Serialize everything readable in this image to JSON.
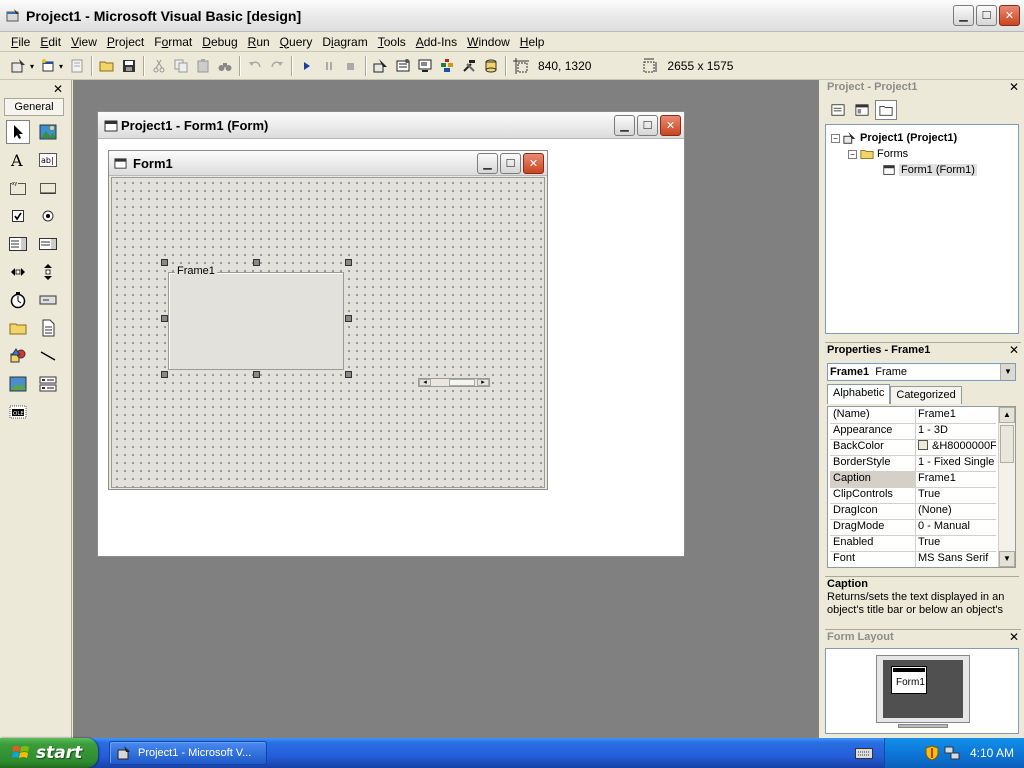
{
  "window": {
    "title": "Project1 - Microsoft Visual Basic [design]"
  },
  "menu": [
    {
      "label": "File",
      "key": "F"
    },
    {
      "label": "Edit",
      "key": "E"
    },
    {
      "label": "View",
      "key": "V"
    },
    {
      "label": "Project",
      "key": "P"
    },
    {
      "label": "Format",
      "key": "o"
    },
    {
      "label": "Debug",
      "key": "D"
    },
    {
      "label": "Run",
      "key": "R"
    },
    {
      "label": "Query",
      "key": "Q"
    },
    {
      "label": "Diagram",
      "key": "i"
    },
    {
      "label": "Tools",
      "key": "T"
    },
    {
      "label": "Add-Ins",
      "key": "A"
    },
    {
      "label": "Window",
      "key": "W"
    },
    {
      "label": "Help",
      "key": "H"
    }
  ],
  "toolbar": {
    "position": "840, 1320",
    "size": "2655 x 1575"
  },
  "toolbox": {
    "tab_label": "General"
  },
  "child_window": {
    "title": "Project1 - Form1 (Form)"
  },
  "form": {
    "title": "Form1",
    "frame_caption": "Frame1"
  },
  "project_explorer": {
    "header": "Project - Project1",
    "root": "Project1 (Project1)",
    "folder": "Forms",
    "item": "Form1 (Form1)"
  },
  "properties": {
    "header": "Properties - Frame1",
    "object_name": "Frame1",
    "object_type": "Frame",
    "tabs": [
      "Alphabetic",
      "Categorized"
    ],
    "rows": [
      {
        "name": "(Name)",
        "value": "Frame1"
      },
      {
        "name": "Appearance",
        "value": "1 - 3D"
      },
      {
        "name": "BackColor",
        "value": "&H8000000F"
      },
      {
        "name": "BorderStyle",
        "value": "1 - Fixed Single"
      },
      {
        "name": "Caption",
        "value": "Frame1"
      },
      {
        "name": "ClipControls",
        "value": "True"
      },
      {
        "name": "DragIcon",
        "value": "(None)"
      },
      {
        "name": "DragMode",
        "value": "0 - Manual"
      },
      {
        "name": "Enabled",
        "value": "True"
      },
      {
        "name": "Font",
        "value": "MS Sans Serif"
      }
    ],
    "selected": "Caption",
    "description_title": "Caption",
    "description_text": "Returns/sets the text displayed in an object's title bar or below an object's"
  },
  "form_layout": {
    "header": "Form Layout",
    "mini_form_label": "Form1"
  },
  "taskbar": {
    "start_label": "start",
    "task_label": "Project1 - Microsoft V...",
    "clock": "4:10 AM"
  },
  "colors": {
    "taskbar_blue": "#245edb",
    "start_green": "#3c9d3c",
    "close_red": "#c8451f"
  }
}
